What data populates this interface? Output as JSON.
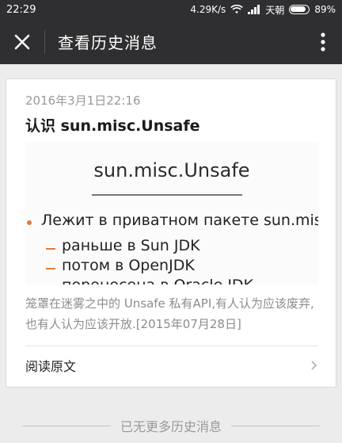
{
  "status_bar": {
    "time": "22:29",
    "network_speed": "4.29K/s",
    "carrier": "天朝",
    "battery": "89%"
  },
  "header": {
    "title": "查看历史消息",
    "close_icon": "close-icon",
    "more_icon": "more-vertical-icon"
  },
  "article": {
    "date": "2016年3月1日22:16",
    "title": "认识 sun.misc.Unsafe",
    "cover": {
      "heading": "sun.misc.Unsafe",
      "lines": [
        "Лежит в приватном пакете sun.misc",
        "раньше в Sun JDK",
        "потом в OpenJDK",
        "перенесена в Oracle JDK"
      ]
    },
    "summary": "笼罩在迷雾之中的 Unsafe 私有API,有人认为应该废弃,也有人认为应该开放.[2015年07月28日]",
    "read_original_label": "阅读原文"
  },
  "footer": {
    "text": "已无更多历史消息"
  },
  "colors": {
    "header_bg": "#2f2f31",
    "page_bg": "#ececec",
    "accent_orange": "#e07b39"
  }
}
